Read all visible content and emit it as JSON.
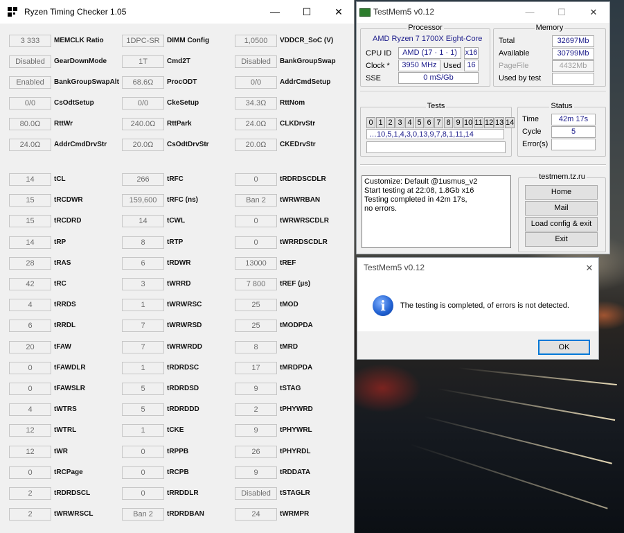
{
  "rtc": {
    "title": "Ryzen Timing Checker 1.05",
    "controls": {
      "minimize": "—",
      "maximize": "☐",
      "close": "✕"
    },
    "columns": [
      [
        {
          "label": "MEMCLK Ratio",
          "value": "3 333"
        },
        {
          "label": "GearDownMode",
          "value": "Disabled"
        },
        {
          "label": "BankGroupSwapAlt",
          "value": "Enabled"
        },
        {
          "label": "CsOdtSetup",
          "value": "0/0"
        },
        {
          "label": "RttWr",
          "value": "80.0Ω"
        },
        {
          "label": "AddrCmdDrvStr",
          "value": "24.0Ω"
        },
        {
          "label": "tCL",
          "value": "14"
        },
        {
          "label": "tRCDWR",
          "value": "15"
        },
        {
          "label": "tRCDRD",
          "value": "15"
        },
        {
          "label": "tRP",
          "value": "14"
        },
        {
          "label": "tRAS",
          "value": "28"
        },
        {
          "label": "tRC",
          "value": "42"
        },
        {
          "label": "tRRDS",
          "value": "4"
        },
        {
          "label": "tRRDL",
          "value": "6"
        },
        {
          "label": "tFAW",
          "value": "20"
        },
        {
          "label": "tFAWDLR",
          "value": "0"
        },
        {
          "label": "tFAWSLR",
          "value": "0"
        },
        {
          "label": "tWTRS",
          "value": "4"
        },
        {
          "label": "tWTRL",
          "value": "12"
        },
        {
          "label": "tWR",
          "value": "12"
        },
        {
          "label": "tRCPage",
          "value": "0"
        },
        {
          "label": "tRDRDSCL",
          "value": "2"
        },
        {
          "label": "tWRWRSCL",
          "value": "2"
        }
      ],
      [
        {
          "label": "DIMM Config",
          "value": "1DPC-SR"
        },
        {
          "label": "Cmd2T",
          "value": "1T"
        },
        {
          "label": "ProcODT",
          "value": "68.6Ω"
        },
        {
          "label": "CkeSetup",
          "value": "0/0"
        },
        {
          "label": "RttPark",
          "value": "240.0Ω"
        },
        {
          "label": "CsOdtDrvStr",
          "value": "20.0Ω"
        },
        {
          "label": "tRFC",
          "value": "266"
        },
        {
          "label": "tRFC (ns)",
          "value": "159,600"
        },
        {
          "label": "tCWL",
          "value": "14"
        },
        {
          "label": "tRTP",
          "value": "8"
        },
        {
          "label": "tRDWR",
          "value": "6"
        },
        {
          "label": "tWRRD",
          "value": "3"
        },
        {
          "label": "tWRWRSC",
          "value": "1"
        },
        {
          "label": "tWRWRSD",
          "value": "7"
        },
        {
          "label": "tWRWRDD",
          "value": "7"
        },
        {
          "label": "tRDRDSC",
          "value": "1"
        },
        {
          "label": "tRDRDSD",
          "value": "5"
        },
        {
          "label": "tRDRDDD",
          "value": "5"
        },
        {
          "label": "tCKE",
          "value": "1"
        },
        {
          "label": "tRPPB",
          "value": "0"
        },
        {
          "label": "tRCPB",
          "value": "0"
        },
        {
          "label": "tRRDDLR",
          "value": "0"
        },
        {
          "label": "tRDRDBAN",
          "value": "Ban 2"
        }
      ],
      [
        {
          "label": "VDDCR_SoC (V)",
          "value": "1,0500"
        },
        {
          "label": "BankGroupSwap",
          "value": "Disabled"
        },
        {
          "label": "AddrCmdSetup",
          "value": "0/0"
        },
        {
          "label": "RttNom",
          "value": "34.3Ω"
        },
        {
          "label": "CLKDrvStr",
          "value": "24.0Ω"
        },
        {
          "label": "CKEDrvStr",
          "value": "20.0Ω"
        },
        {
          "label": "tRDRDSCDLR",
          "value": "0"
        },
        {
          "label": "tWRWRBAN",
          "value": "Ban 2"
        },
        {
          "label": "tWRWRSCDLR",
          "value": "0"
        },
        {
          "label": "tWRRDSCDLR",
          "value": "0"
        },
        {
          "label": "tREF",
          "value": "13000"
        },
        {
          "label": "tREF (µs)",
          "value": "7 800"
        },
        {
          "label": "tMOD",
          "value": "25"
        },
        {
          "label": "tMODPDA",
          "value": "25"
        },
        {
          "label": "tMRD",
          "value": "8"
        },
        {
          "label": "tMRDPDA",
          "value": "17"
        },
        {
          "label": "tSTAG",
          "value": "9"
        },
        {
          "label": "tPHYWRD",
          "value": "2"
        },
        {
          "label": "tPHYWRL",
          "value": "9"
        },
        {
          "label": "tPHYRDL",
          "value": "26"
        },
        {
          "label": "tRDDATA",
          "value": "9"
        },
        {
          "label": "tSTAGLR",
          "value": "Disabled"
        },
        {
          "label": "tWRMPR",
          "value": "24"
        }
      ]
    ]
  },
  "testmem": {
    "title": "TestMem5 v0.12",
    "controls": {
      "minimize": "—",
      "maximize": "☐",
      "close": "✕"
    },
    "processor": {
      "group_title": "Processor",
      "name": "AMD Ryzen 7 1700X Eight-Core",
      "cpu_id_label": "CPU ID",
      "cpu_id_value": "AMD  (17 · 1 · 1)",
      "cpu_threads": "x16",
      "clock_label": "Clock *",
      "clock_value": "3950 MHz",
      "used_label": "Used",
      "used_value": "16",
      "sse_label": "SSE",
      "sse_value": "0 mS/Gb"
    },
    "memory": {
      "group_title": "Memory",
      "total_label": "Total",
      "total_value": "32697Mb",
      "available_label": "Available",
      "available_value": "30799Mb",
      "pagefile_label": "PageFile",
      "pagefile_value": "4432Mb",
      "used_by_test_label": "Used by test",
      "used_by_test_value": ""
    },
    "tests": {
      "group_title": "Tests",
      "cells": [
        "0",
        "1",
        "2",
        "3",
        "4",
        "5",
        "6",
        "7",
        "8",
        "9",
        "10",
        "11",
        "12",
        "13",
        "14"
      ],
      "sequence": "…10,5,1,4,3,0,13,9,7,8,1,11,14",
      "progress": ""
    },
    "status": {
      "group_title": "Status",
      "time_label": "Time",
      "time_value": "42m 17s",
      "cycle_label": "Cycle",
      "cycle_value": "5",
      "errors_label": "Error(s)",
      "errors_value": ""
    },
    "log": [
      "Customize: Default @1usmus_v2",
      "Start testing at 22:08, 1.8Gb x16",
      "Testing completed in 42m 17s,",
      "no errors."
    ],
    "site": {
      "group_title": "testmem.tz.ru",
      "home": "Home",
      "mail": "Mail",
      "load": "Load config & exit",
      "exit": "Exit"
    }
  },
  "dialog": {
    "title": "TestMem5 v0.12",
    "close": "✕",
    "icon_glyph": "i",
    "message": "The testing is completed, of errors is not detected.",
    "ok": "OK"
  },
  "colors": {
    "accent": "#0078d7",
    "value_text": "#1a1a8a"
  }
}
